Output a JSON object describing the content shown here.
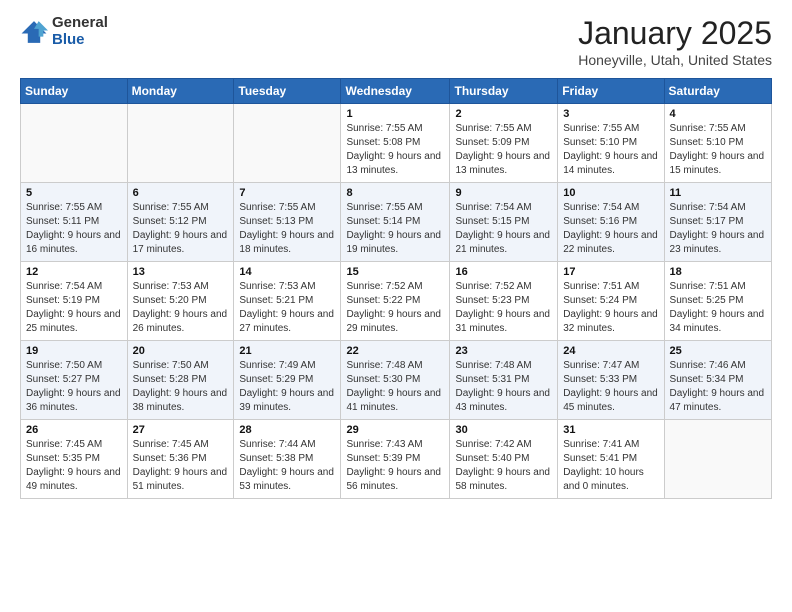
{
  "logo": {
    "general": "General",
    "blue": "Blue"
  },
  "header": {
    "month": "January 2025",
    "location": "Honeyville, Utah, United States"
  },
  "weekdays": [
    "Sunday",
    "Monday",
    "Tuesday",
    "Wednesday",
    "Thursday",
    "Friday",
    "Saturday"
  ],
  "weeks": [
    [
      {
        "day": "",
        "info": ""
      },
      {
        "day": "",
        "info": ""
      },
      {
        "day": "",
        "info": ""
      },
      {
        "day": "1",
        "info": "Sunrise: 7:55 AM\nSunset: 5:08 PM\nDaylight: 9 hours and 13 minutes."
      },
      {
        "day": "2",
        "info": "Sunrise: 7:55 AM\nSunset: 5:09 PM\nDaylight: 9 hours and 13 minutes."
      },
      {
        "day": "3",
        "info": "Sunrise: 7:55 AM\nSunset: 5:10 PM\nDaylight: 9 hours and 14 minutes."
      },
      {
        "day": "4",
        "info": "Sunrise: 7:55 AM\nSunset: 5:10 PM\nDaylight: 9 hours and 15 minutes."
      }
    ],
    [
      {
        "day": "5",
        "info": "Sunrise: 7:55 AM\nSunset: 5:11 PM\nDaylight: 9 hours and 16 minutes."
      },
      {
        "day": "6",
        "info": "Sunrise: 7:55 AM\nSunset: 5:12 PM\nDaylight: 9 hours and 17 minutes."
      },
      {
        "day": "7",
        "info": "Sunrise: 7:55 AM\nSunset: 5:13 PM\nDaylight: 9 hours and 18 minutes."
      },
      {
        "day": "8",
        "info": "Sunrise: 7:55 AM\nSunset: 5:14 PM\nDaylight: 9 hours and 19 minutes."
      },
      {
        "day": "9",
        "info": "Sunrise: 7:54 AM\nSunset: 5:15 PM\nDaylight: 9 hours and 21 minutes."
      },
      {
        "day": "10",
        "info": "Sunrise: 7:54 AM\nSunset: 5:16 PM\nDaylight: 9 hours and 22 minutes."
      },
      {
        "day": "11",
        "info": "Sunrise: 7:54 AM\nSunset: 5:17 PM\nDaylight: 9 hours and 23 minutes."
      }
    ],
    [
      {
        "day": "12",
        "info": "Sunrise: 7:54 AM\nSunset: 5:19 PM\nDaylight: 9 hours and 25 minutes."
      },
      {
        "day": "13",
        "info": "Sunrise: 7:53 AM\nSunset: 5:20 PM\nDaylight: 9 hours and 26 minutes."
      },
      {
        "day": "14",
        "info": "Sunrise: 7:53 AM\nSunset: 5:21 PM\nDaylight: 9 hours and 27 minutes."
      },
      {
        "day": "15",
        "info": "Sunrise: 7:52 AM\nSunset: 5:22 PM\nDaylight: 9 hours and 29 minutes."
      },
      {
        "day": "16",
        "info": "Sunrise: 7:52 AM\nSunset: 5:23 PM\nDaylight: 9 hours and 31 minutes."
      },
      {
        "day": "17",
        "info": "Sunrise: 7:51 AM\nSunset: 5:24 PM\nDaylight: 9 hours and 32 minutes."
      },
      {
        "day": "18",
        "info": "Sunrise: 7:51 AM\nSunset: 5:25 PM\nDaylight: 9 hours and 34 minutes."
      }
    ],
    [
      {
        "day": "19",
        "info": "Sunrise: 7:50 AM\nSunset: 5:27 PM\nDaylight: 9 hours and 36 minutes."
      },
      {
        "day": "20",
        "info": "Sunrise: 7:50 AM\nSunset: 5:28 PM\nDaylight: 9 hours and 38 minutes."
      },
      {
        "day": "21",
        "info": "Sunrise: 7:49 AM\nSunset: 5:29 PM\nDaylight: 9 hours and 39 minutes."
      },
      {
        "day": "22",
        "info": "Sunrise: 7:48 AM\nSunset: 5:30 PM\nDaylight: 9 hours and 41 minutes."
      },
      {
        "day": "23",
        "info": "Sunrise: 7:48 AM\nSunset: 5:31 PM\nDaylight: 9 hours and 43 minutes."
      },
      {
        "day": "24",
        "info": "Sunrise: 7:47 AM\nSunset: 5:33 PM\nDaylight: 9 hours and 45 minutes."
      },
      {
        "day": "25",
        "info": "Sunrise: 7:46 AM\nSunset: 5:34 PM\nDaylight: 9 hours and 47 minutes."
      }
    ],
    [
      {
        "day": "26",
        "info": "Sunrise: 7:45 AM\nSunset: 5:35 PM\nDaylight: 9 hours and 49 minutes."
      },
      {
        "day": "27",
        "info": "Sunrise: 7:45 AM\nSunset: 5:36 PM\nDaylight: 9 hours and 51 minutes."
      },
      {
        "day": "28",
        "info": "Sunrise: 7:44 AM\nSunset: 5:38 PM\nDaylight: 9 hours and 53 minutes."
      },
      {
        "day": "29",
        "info": "Sunrise: 7:43 AM\nSunset: 5:39 PM\nDaylight: 9 hours and 56 minutes."
      },
      {
        "day": "30",
        "info": "Sunrise: 7:42 AM\nSunset: 5:40 PM\nDaylight: 9 hours and 58 minutes."
      },
      {
        "day": "31",
        "info": "Sunrise: 7:41 AM\nSunset: 5:41 PM\nDaylight: 10 hours and 0 minutes."
      },
      {
        "day": "",
        "info": ""
      }
    ]
  ]
}
